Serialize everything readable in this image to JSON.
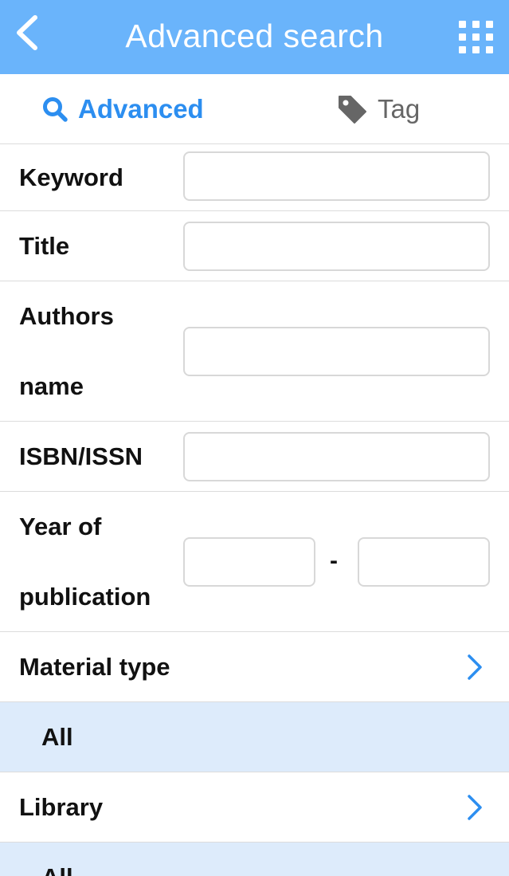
{
  "header": {
    "title": "Advanced search",
    "back_icon": "chevron-left-icon",
    "menu_icon": "grid-icon"
  },
  "tabs": [
    {
      "label": "Advanced",
      "icon": "search-icon",
      "active": true
    },
    {
      "label": "Tag",
      "icon": "tag-icon",
      "active": false
    }
  ],
  "form": {
    "keyword_label": "Keyword",
    "keyword_value": "",
    "title_label": "Title",
    "title_value": "",
    "authors_label_line1": "Authors",
    "authors_label_line2": "name",
    "authors_value": "",
    "isbn_label": "ISBN/ISSN",
    "isbn_value": "",
    "year_label_line1": "Year of",
    "year_label_line2": "publication",
    "year_from_value": "",
    "year_separator": "-",
    "year_to_value": "",
    "material_label": "Material type",
    "material_value": "All",
    "library_label": "Library",
    "library_value": "All"
  },
  "colors": {
    "header_bg": "#6ab4fb",
    "accent": "#2c8ef0",
    "selected_row_bg": "#ddebfb",
    "divider": "#dcdcdc"
  }
}
